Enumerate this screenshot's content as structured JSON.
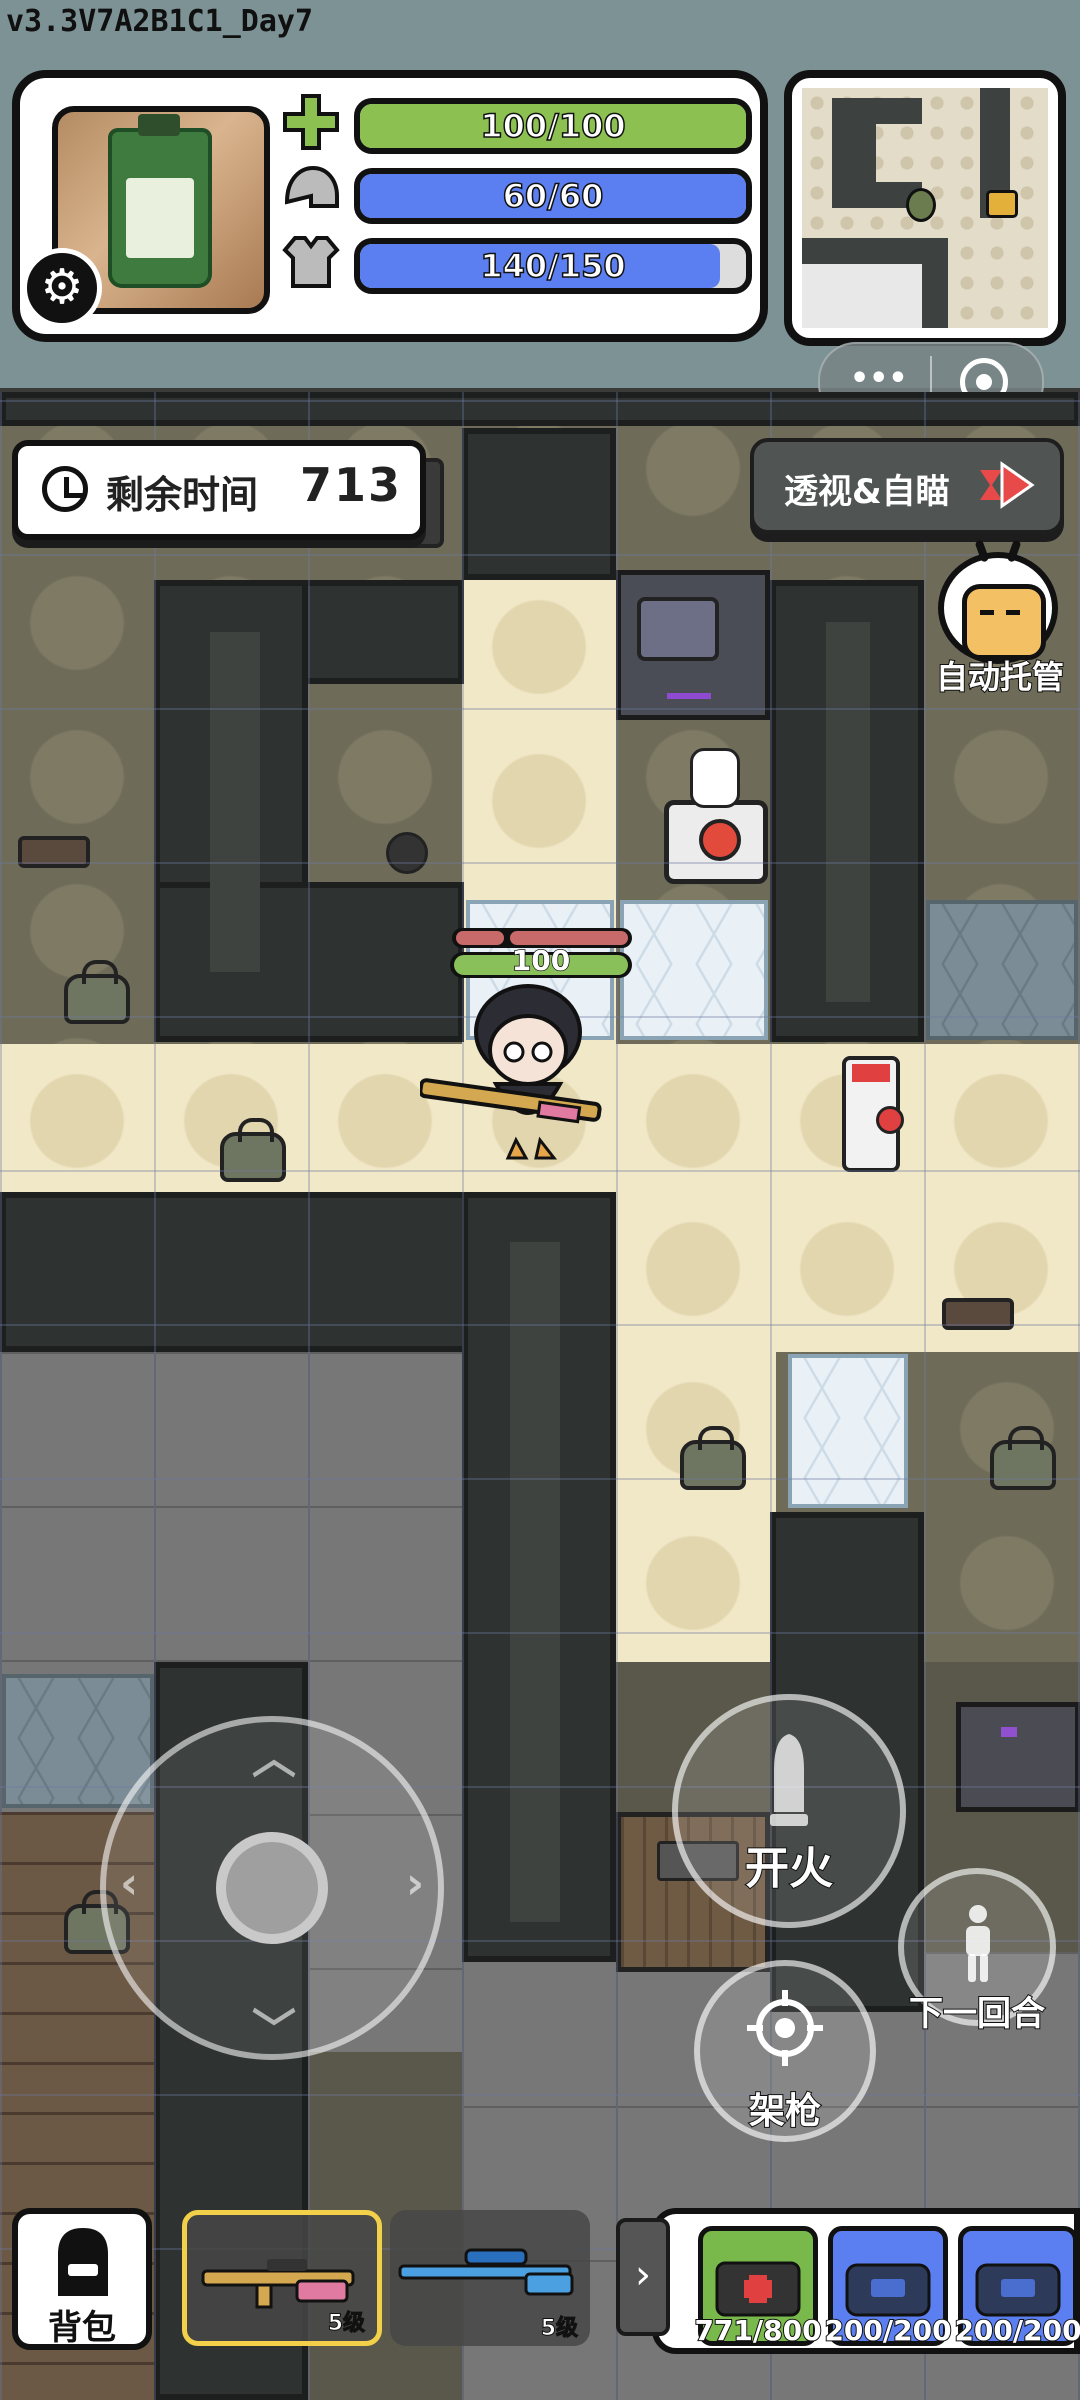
{
  "version": "v3.3V7A2B1C1_Day7",
  "stats": {
    "health": {
      "label": "100/100",
      "fraction": 1.0,
      "color": "#8cc152"
    },
    "helmet": {
      "label": "60/60",
      "fraction": 1.0,
      "color": "#5b7ff0"
    },
    "armor": {
      "label": "140/150",
      "fraction": 0.933,
      "color": "#5b7ff0"
    }
  },
  "timer": {
    "label": "剩余时间",
    "value": "713"
  },
  "xray_button": {
    "label": "透视&自瞄"
  },
  "autopilot": {
    "label": "自动托管"
  },
  "player": {
    "hp": "100",
    "hp_fraction": 1.0
  },
  "controls": {
    "fire": "开火",
    "aim": "架枪",
    "next_round": "下一回合"
  },
  "bottom_bar": {
    "backpack": "背包",
    "weapons": [
      {
        "level": "5级",
        "selected": true
      },
      {
        "level": "5级",
        "selected": false
      }
    ],
    "supplies": [
      {
        "icon": "medkit-icon",
        "count": "771/800"
      },
      {
        "icon": "helmet-repair-icon",
        "count": "200/200"
      },
      {
        "icon": "armor-repair-icon",
        "count": "200/200"
      }
    ]
  },
  "colors": {
    "accent_green": "#8cc152",
    "accent_blue": "#5b7ff0",
    "arrow_red": "#e84a4a"
  }
}
